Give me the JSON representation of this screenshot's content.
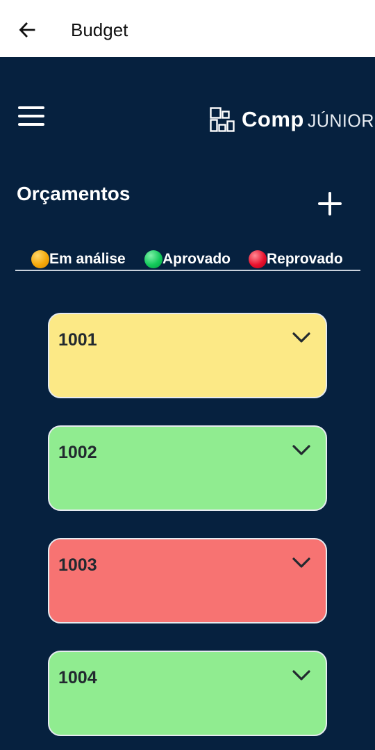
{
  "appbar": {
    "title": "Budget"
  },
  "brand": {
    "name": "Comp",
    "suffix": "JÚNIOR"
  },
  "section": {
    "title": "Orçamentos"
  },
  "legend": [
    {
      "label": "Em análise",
      "color": "#f5a80a"
    },
    {
      "label": "Aprovado",
      "color": "#12c85a"
    },
    {
      "label": "Reprovado",
      "color": "#e8112d"
    }
  ],
  "budgets": [
    {
      "id": "1001",
      "status": "Em análise",
      "color": "#fce986"
    },
    {
      "id": "1002",
      "status": "Aprovado",
      "color": "#90ec90"
    },
    {
      "id": "1003",
      "status": "Reprovado",
      "color": "#f77372"
    },
    {
      "id": "1004",
      "status": "Aprovado",
      "color": "#90ec90"
    }
  ]
}
